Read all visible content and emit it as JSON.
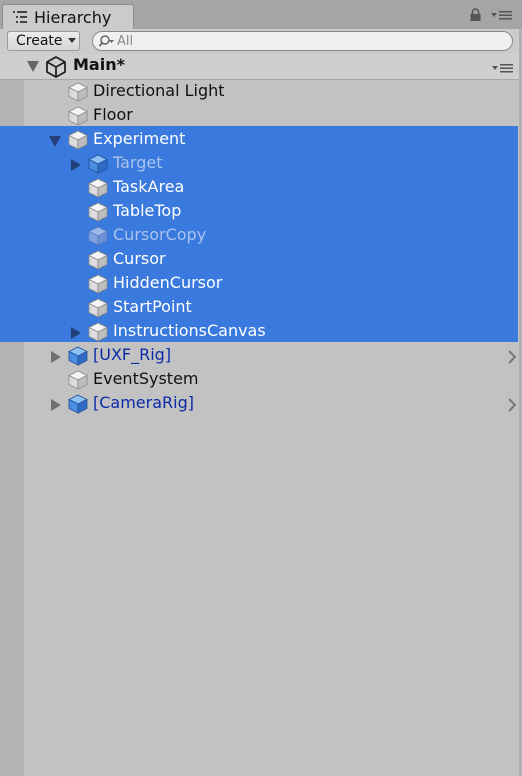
{
  "tab": {
    "title": "Hierarchy"
  },
  "toolbar": {
    "create_label": "Create",
    "search_placeholder": "All"
  },
  "scene": {
    "name": "Main*"
  },
  "colors": {
    "selection": "#3a79dd",
    "prefab_text": "#0b2aa8",
    "panel": "#c2c2c2"
  },
  "items": [
    {
      "label": "Directional Light",
      "icon": "gameobject-cube-icon",
      "depth": 1,
      "fold": "none",
      "selected": false,
      "style": "normal"
    },
    {
      "label": "Floor",
      "icon": "gameobject-cube-icon",
      "depth": 1,
      "fold": "none",
      "selected": false,
      "style": "normal"
    },
    {
      "label": "Experiment",
      "icon": "gameobject-cube-icon",
      "depth": 1,
      "fold": "open",
      "selected": true,
      "style": "normal"
    },
    {
      "label": "Target",
      "icon": "prefab-cube-icon",
      "depth": 2,
      "fold": "closed",
      "selected": true,
      "style": "inactive"
    },
    {
      "label": "TaskArea",
      "icon": "gameobject-cube-icon",
      "depth": 2,
      "fold": "none",
      "selected": true,
      "style": "normal"
    },
    {
      "label": "TableTop",
      "icon": "gameobject-cube-icon",
      "depth": 2,
      "fold": "none",
      "selected": true,
      "style": "normal"
    },
    {
      "label": "CursorCopy",
      "icon": "gameobject-cube-icon",
      "depth": 2,
      "fold": "none",
      "selected": true,
      "style": "inactive"
    },
    {
      "label": "Cursor",
      "icon": "gameobject-cube-icon",
      "depth": 2,
      "fold": "none",
      "selected": true,
      "style": "normal"
    },
    {
      "label": "HiddenCursor",
      "icon": "gameobject-cube-icon",
      "depth": 2,
      "fold": "none",
      "selected": true,
      "style": "normal"
    },
    {
      "label": "StartPoint",
      "icon": "gameobject-cube-icon",
      "depth": 2,
      "fold": "none",
      "selected": true,
      "style": "normal"
    },
    {
      "label": "InstructionsCanvas",
      "icon": "gameobject-cube-icon",
      "depth": 2,
      "fold": "closed",
      "selected": true,
      "style": "normal"
    },
    {
      "label": "[UXF_Rig]",
      "icon": "prefab-cube-icon",
      "depth": 1,
      "fold": "closed",
      "selected": false,
      "style": "prefab",
      "open_prefab": true
    },
    {
      "label": "EventSystem",
      "icon": "gameobject-cube-icon",
      "depth": 1,
      "fold": "none",
      "selected": false,
      "style": "normal"
    },
    {
      "label": "[CameraRig]",
      "icon": "prefab-cube-icon",
      "depth": 1,
      "fold": "closed",
      "selected": false,
      "style": "prefab",
      "open_prefab": true
    }
  ]
}
